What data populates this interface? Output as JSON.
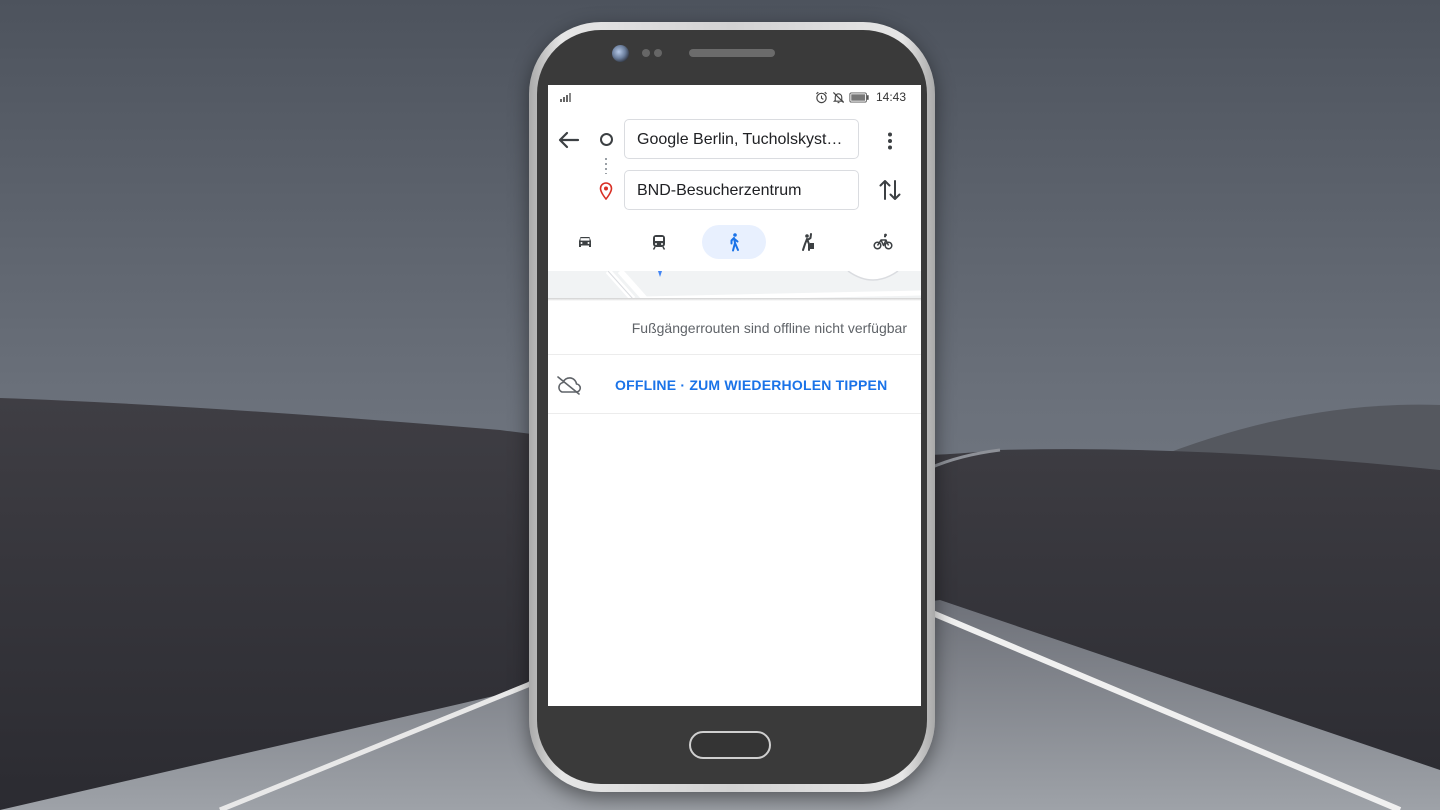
{
  "status_bar": {
    "time": "14:43"
  },
  "directions": {
    "start_field": "Google Berlin, Tucholskyst…",
    "destination_field": "BND-Besucherzentrum"
  },
  "travel_modes": [
    {
      "name": "car-icon",
      "active": false
    },
    {
      "name": "transit-icon",
      "active": false
    },
    {
      "name": "walking-icon",
      "active": true
    },
    {
      "name": "ride-hailing-icon",
      "active": false
    },
    {
      "name": "bicycle-icon",
      "active": false
    }
  ],
  "notice": "Fußgängerrouten sind offline nicht verfügbar",
  "offline_retry": "OFFLINE · ZUM WIEDERHOLEN TIPPEN",
  "colors": {
    "accent": "#1a73e8",
    "active_mode_bg": "#e8f0fe",
    "destination_pin": "#d93025"
  }
}
